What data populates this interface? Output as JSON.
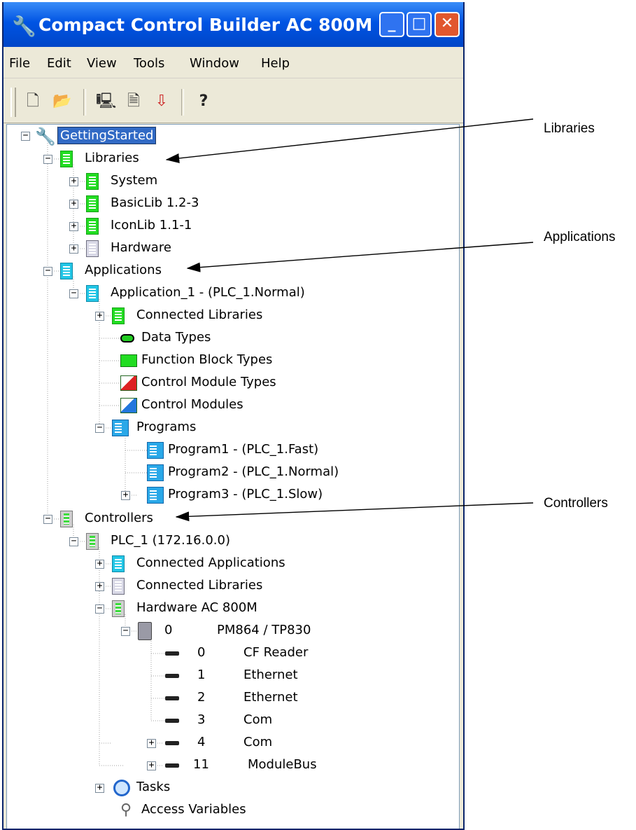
{
  "window": {
    "title": "Compact Control Builder AC 800M ...",
    "buttons": {
      "minimize": "_",
      "maximize": "□",
      "close": "✕"
    }
  },
  "menu": [
    "File",
    "Edit",
    "View",
    "Tools",
    "Window",
    "Help"
  ],
  "toolbar": {
    "icons": [
      "new-document-icon",
      "open-folder-icon",
      "download-icon",
      "list-download-icon",
      "program-download-icon",
      "help-icon"
    ],
    "glyphs": [
      "🗋",
      "📂",
      "🖳",
      "🗎",
      "⇩",
      "?"
    ]
  },
  "tree": {
    "root": {
      "label": "GettingStarted",
      "glyph": "🔧"
    },
    "libraries": {
      "label": "Libraries",
      "system": "System",
      "basiclib": "BasicLib 1.2-3",
      "iconlib": "IconLib 1.1-1",
      "hardware": "Hardware"
    },
    "applications": {
      "label": "Applications",
      "app1": "Application_1 - (PLC_1.Normal)",
      "connected_libraries": "Connected Libraries",
      "data_types": "Data Types",
      "fb_types": "Function Block Types",
      "cm_types": "Control Module Types",
      "control_modules": "Control Modules",
      "programs": "Programs",
      "program1": "Program1 - (PLC_1.Fast)",
      "program2": "Program2 - (PLC_1.Normal)",
      "program3": "Program3 - (PLC_1.Slow)"
    },
    "controllers": {
      "label": "Controllers",
      "plc1": "PLC_1 (172.16.0.0)",
      "connected_applications": "Connected Applications",
      "connected_libraries": "Connected Libraries",
      "hardware": "Hardware  AC 800M",
      "cpu": {
        "pos": "0",
        "name": "PM864 / TP830"
      },
      "units": [
        {
          "pos": "0",
          "name": "CF Reader"
        },
        {
          "pos": "1",
          "name": "Ethernet"
        },
        {
          "pos": "2",
          "name": "Ethernet"
        },
        {
          "pos": "3",
          "name": "Com"
        },
        {
          "pos": "4",
          "name": "Com"
        },
        {
          "pos": "11",
          "name": "ModuleBus"
        }
      ],
      "tasks": "Tasks",
      "access_variables": "Access Variables"
    }
  },
  "callouts": {
    "libraries": "Libraries",
    "applications": "Applications",
    "controllers": "Controllers"
  }
}
